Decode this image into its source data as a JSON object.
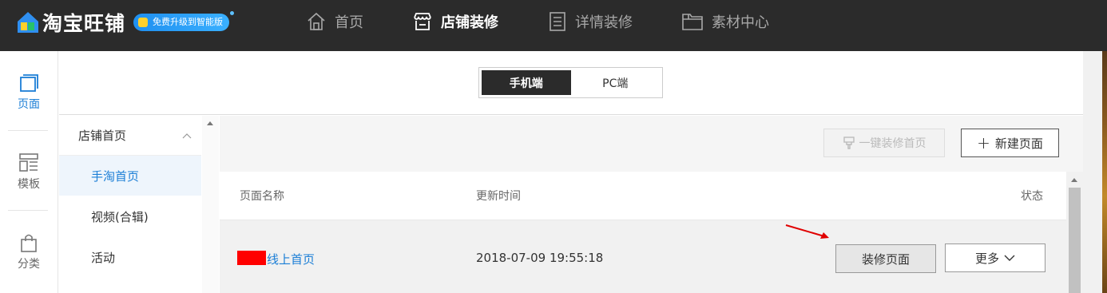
{
  "header": {
    "logo_text": "淘宝旺铺",
    "upgrade_badge": "免费升级到智能版",
    "nav": [
      {
        "label": "首页",
        "icon": "home-icon",
        "active": false
      },
      {
        "label": "店铺装修",
        "icon": "store-icon",
        "active": true
      },
      {
        "label": "详情装修",
        "icon": "document-icon",
        "active": false
      },
      {
        "label": "素材中心",
        "icon": "folder-icon",
        "active": false
      }
    ]
  },
  "rail": {
    "items": [
      {
        "label": "页面",
        "icon": "page-icon",
        "active": true
      },
      {
        "label": "模板",
        "icon": "template-icon",
        "active": false
      },
      {
        "label": "分类",
        "icon": "bag-icon",
        "active": false
      }
    ]
  },
  "device_toggle": {
    "mobile": "手机端",
    "pc": "PC端",
    "selected": "手机端"
  },
  "category": {
    "header": "店铺首页",
    "items": [
      "手淘首页",
      "视频(合辑)",
      "活动"
    ],
    "selected": "手淘首页"
  },
  "toolbar": {
    "onekey_label": "一键装修首页",
    "new_page_label": "新建页面"
  },
  "table": {
    "columns": [
      "页面名称",
      "更新时间",
      "状态"
    ],
    "rows": [
      {
        "name": "线上首页",
        "updated": "2018-07-09 19:55:18",
        "action": "装修页面",
        "more": "更多"
      }
    ]
  },
  "colors": {
    "topbar": "#2b2b2b",
    "accent": "#1b7ed6",
    "annotation": "#e00000"
  }
}
